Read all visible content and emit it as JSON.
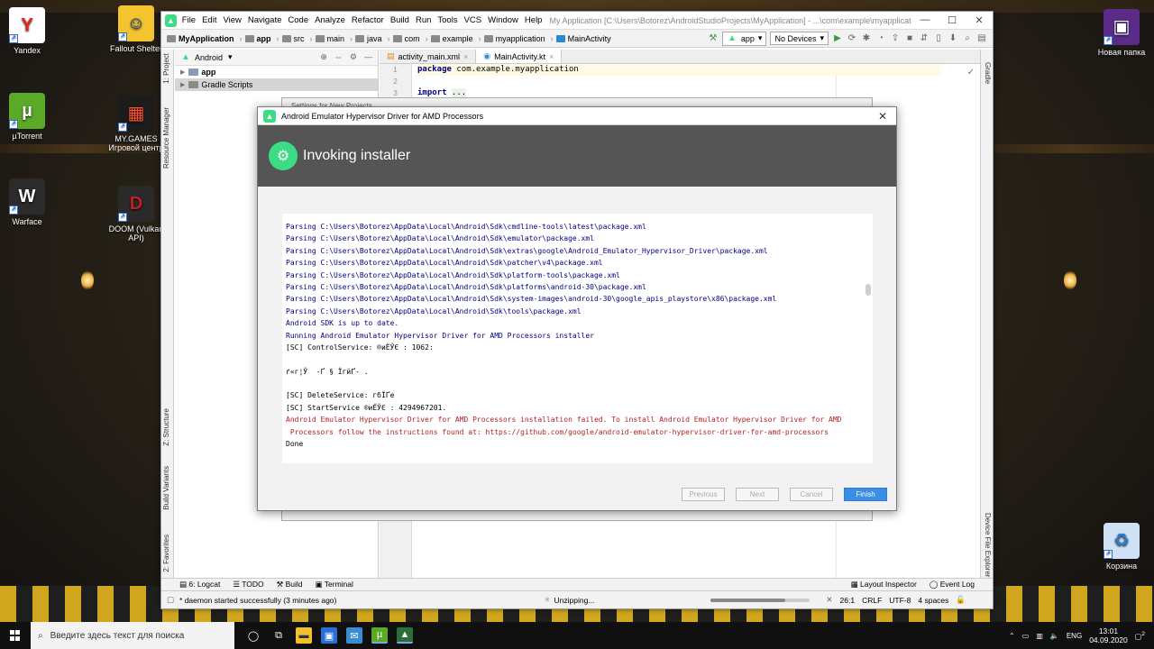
{
  "desktop": {
    "icons_left": [
      {
        "label": "Yandex",
        "glyph": "Y",
        "color": "#e52620",
        "bg": "#ffffff"
      },
      {
        "label": "µTorrent",
        "glyph": "µ",
        "color": "#ffffff",
        "bg": "#5aaa28"
      },
      {
        "label": "Warface",
        "glyph": "W",
        "color": "#ffffff",
        "bg": "#2b2b2b"
      }
    ],
    "icons_mid": [
      {
        "label": "Fallout Shelter",
        "glyph": "☺",
        "color": "#1a4f9c",
        "bg": "#f3c42d"
      },
      {
        "label": "MY.GAMES\nИгровой центр",
        "glyph": "▦",
        "color": "#ff5030",
        "bg": "#1c1c1c"
      },
      {
        "label": "DOOM (Vulkan\nAPI)",
        "glyph": "D",
        "color": "#c02020",
        "bg": "#2a2a2a"
      }
    ],
    "icons_right": [
      {
        "label": "Новая папка",
        "glyph": "▣",
        "color": "#ffffff",
        "bg": "#5b2b8a"
      },
      {
        "label": "Корзина",
        "glyph": "♻",
        "color": "#2a7bd0",
        "bg": "#cfe2f5"
      }
    ]
  },
  "ide": {
    "menu": [
      "File",
      "Edit",
      "View",
      "Navigate",
      "Code",
      "Analyze",
      "Refactor",
      "Build",
      "Run",
      "Tools",
      "VCS",
      "Window",
      "Help"
    ],
    "window_title": "My Application [C:\\Users\\Botorez\\AndroidStudioProjects\\MyApplication] - ...\\com\\example\\myapplication\\MainActivity.kt",
    "breadcrumbs": [
      "MyApplication",
      "app",
      "src",
      "main",
      "java",
      "com",
      "example",
      "myapplication",
      "MainActivity"
    ],
    "run_config": "app",
    "device": "No Devices",
    "project_view": "Android",
    "tree": [
      "app",
      "Gradle Scripts"
    ],
    "left_tabs": [
      "1: Project",
      "Resource Manager",
      "Z: Structure",
      "Build Variants",
      "2: Favorites"
    ],
    "right_tabs": [
      "Gradle",
      "Device File Explorer"
    ],
    "editor_tabs": [
      "activity_main.xml",
      "MainActivity.kt"
    ],
    "line_numbers": [
      "1",
      "2",
      "3"
    ],
    "code": {
      "kw1": "package",
      "pkg": "com.example.myapplication",
      "kw2": "import",
      "dots": "..."
    },
    "bottom_tabs": [
      "6: Logcat",
      "TODO",
      "Build",
      "Terminal"
    ],
    "bottom_right_tabs": [
      "Layout Inspector",
      "Event Log"
    ],
    "status_message": "* daemon started successfully (3 minutes ago)",
    "status_task": "Unzipping...",
    "status_progress": 0.75,
    "status_pos": "26:1",
    "status_eol": "CRLF",
    "status_enc": "UTF-8",
    "status_indent": "4 spaces"
  },
  "back_dialog": {
    "title": "Settings for New Projects"
  },
  "dialog": {
    "title": "Android Emulator Hypervisor Driver for AMD Processors",
    "heading": "Invoking installer",
    "log": [
      {
        "t": "Parsing C:\\Users\\Botorez\\AppData\\Local\\Android\\Sdk\\cmdline-tools\\latest\\package.xml",
        "c": "b"
      },
      {
        "t": "Parsing C:\\Users\\Botorez\\AppData\\Local\\Android\\Sdk\\emulator\\package.xml",
        "c": "b"
      },
      {
        "t": "Parsing C:\\Users\\Botorez\\AppData\\Local\\Android\\Sdk\\extras\\google\\Android_Emulator_Hypervisor_Driver\\package.xml",
        "c": "b"
      },
      {
        "t": "Parsing C:\\Users\\Botorez\\AppData\\Local\\Android\\Sdk\\patcher\\v4\\package.xml",
        "c": "b"
      },
      {
        "t": "Parsing C:\\Users\\Botorez\\AppData\\Local\\Android\\Sdk\\platform-tools\\package.xml",
        "c": "b"
      },
      {
        "t": "Parsing C:\\Users\\Botorez\\AppData\\Local\\Android\\Sdk\\platforms\\android-30\\package.xml",
        "c": "b"
      },
      {
        "t": "Parsing C:\\Users\\Botorez\\AppData\\Local\\Android\\Sdk\\system-images\\android-30\\google_apis_playstore\\x86\\package.xml",
        "c": "b"
      },
      {
        "t": "Parsing C:\\Users\\Botorez\\AppData\\Local\\Android\\Sdk\\tools\\package.xml",
        "c": "b"
      },
      {
        "t": "Android SDK is up to date.",
        "c": "b"
      },
      {
        "t": "Running Android Emulator Hypervisor Driver for AMD Processors installer",
        "c": "b"
      },
      {
        "t": "[SC] ControlService: ®иЁЎЄ : 1062:",
        "c": "k"
      },
      {
        "t": "",
        "c": "k"
      },
      {
        "t": "ґ«г¦Ў  -Ґ § ЇгйҐ- .",
        "c": "k"
      },
      {
        "t": "",
        "c": "k"
      },
      {
        "t": "[SC] DeleteService: гбЇҐе",
        "c": "k"
      },
      {
        "t": "[SC] StartService ®иЁЎЄ : 4294967201.",
        "c": "k"
      },
      {
        "t": "Android Emulator Hypervisor Driver for AMD Processors installation failed. To install Android Emulator Hypervisor Driver for AMD",
        "c": "r"
      },
      {
        "t": " Processors follow the instructions found at: https://github.com/google/android-emulator-hypervisor-driver-for-amd-processors",
        "c": "r"
      },
      {
        "t": "Done",
        "c": "k"
      }
    ],
    "buttons": {
      "previous": "Previous",
      "next": "Next",
      "cancel": "Cancel",
      "finish": "Finish"
    }
  },
  "taskbar": {
    "search_placeholder": "Введите здесь текст для поиска",
    "lang": "ENG",
    "time": "13:01",
    "date": "04.09.2020",
    "notif_count": "2"
  }
}
